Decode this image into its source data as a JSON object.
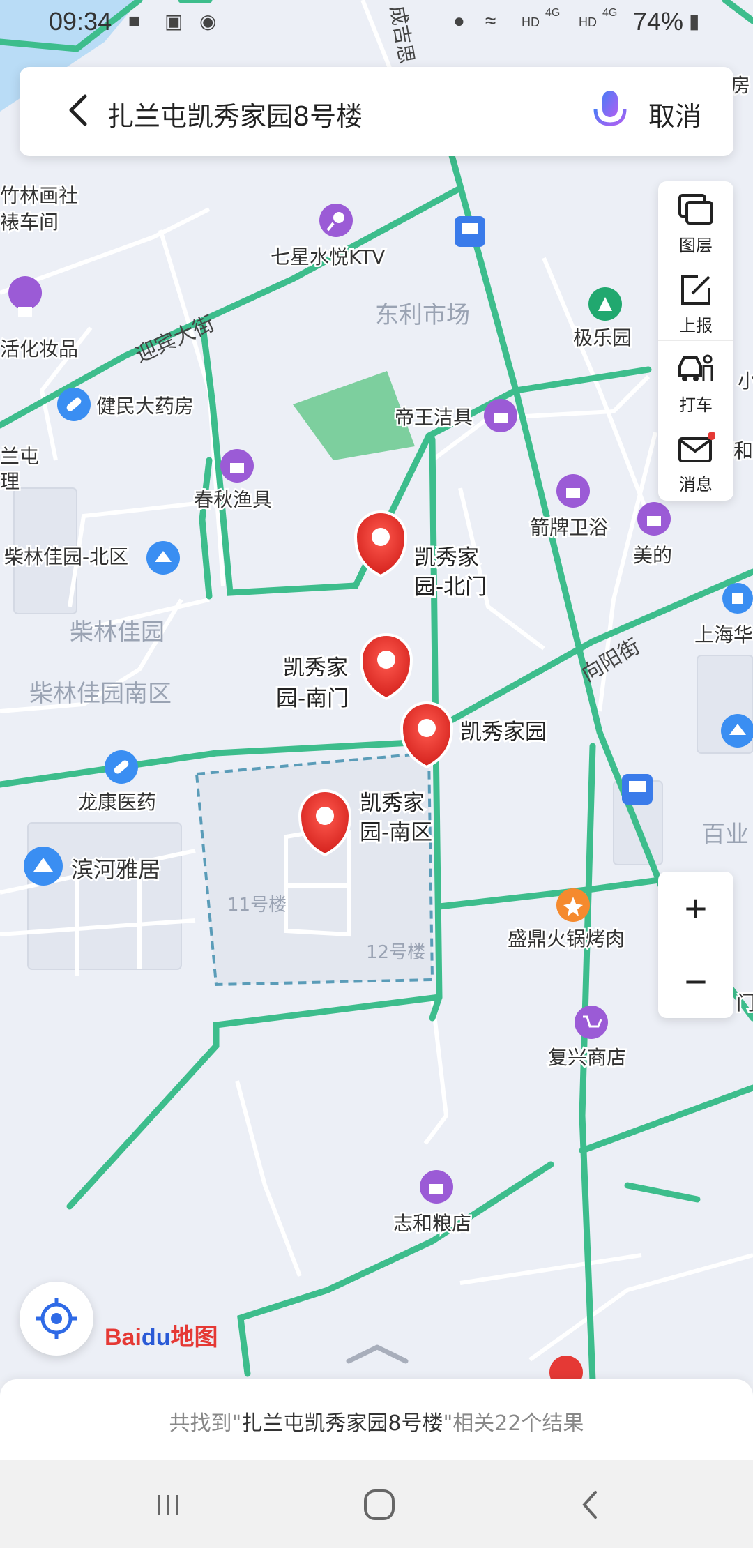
{
  "status_bar": {
    "time": "09:34",
    "hd1": "HD",
    "net1": "4G",
    "hd2": "HD",
    "net2": "4G",
    "battery": "74%"
  },
  "search": {
    "query": "扎兰屯凯秀家园8号楼",
    "cancel_label": "取消"
  },
  "tools": {
    "layers": "图层",
    "report": "上报",
    "taxi": "打车",
    "messages": "消息"
  },
  "zoom": {
    "in": "+",
    "out": "−"
  },
  "map": {
    "streets": {
      "yingbin": "迎宾大街",
      "xiangyang": "向阳街",
      "chengjisi": "成吉思"
    },
    "areas": {
      "dongli": "东利市场",
      "chailin_garden": "柴林佳园",
      "chailin_south": "柴林佳园南区",
      "baiye": "百业",
      "bldg11": "11号楼",
      "bldg12": "12号楼"
    },
    "pois": {
      "zhulin": "竹林画社",
      "chejian": "裱车间",
      "qixing": "七星水悦KTV",
      "cosmetics": "活化妆品",
      "jianmin": "健民大药房",
      "jile": "极乐园",
      "diwang": "帝王洁具",
      "tun": "兰屯",
      "li": "理",
      "chunqiu": "春秋渔具",
      "jianpai": "箭牌卫浴",
      "meide": "美的",
      "chailin_north": "柴林佳园-北区",
      "shanghai": "上海华",
      "longkang": "龙康医药",
      "binhe": "滨河雅居",
      "shengding": "盛鼎火锅烤肉",
      "fuxing": "复兴商店",
      "zhihe": "志和粮店",
      "men": "门",
      "fang": "房",
      "xiao": "小",
      "he": "和"
    },
    "markers": {
      "north_gate": [
        "凯秀家",
        "园-北门"
      ],
      "south_gate": [
        "凯秀家",
        "园-南门"
      ],
      "main": "凯秀家园",
      "south_area": [
        "凯秀家",
        "园-南区"
      ]
    }
  },
  "baidu_logo": {
    "bai": "Bai",
    "du": "du",
    "ditu": "地图"
  },
  "results": {
    "prefix": "共找到\"",
    "query": "扎兰屯凯秀家园8号楼",
    "suffix": "\"相关22个结果"
  },
  "colors": {
    "road_green": "#3dbd8c",
    "map_bg": "#eceff6",
    "marker_red": "#e8322e",
    "poi_purple": "#9b5bd6",
    "boundary": "#5a9cb8",
    "bus_blue": "#3a7bea"
  }
}
